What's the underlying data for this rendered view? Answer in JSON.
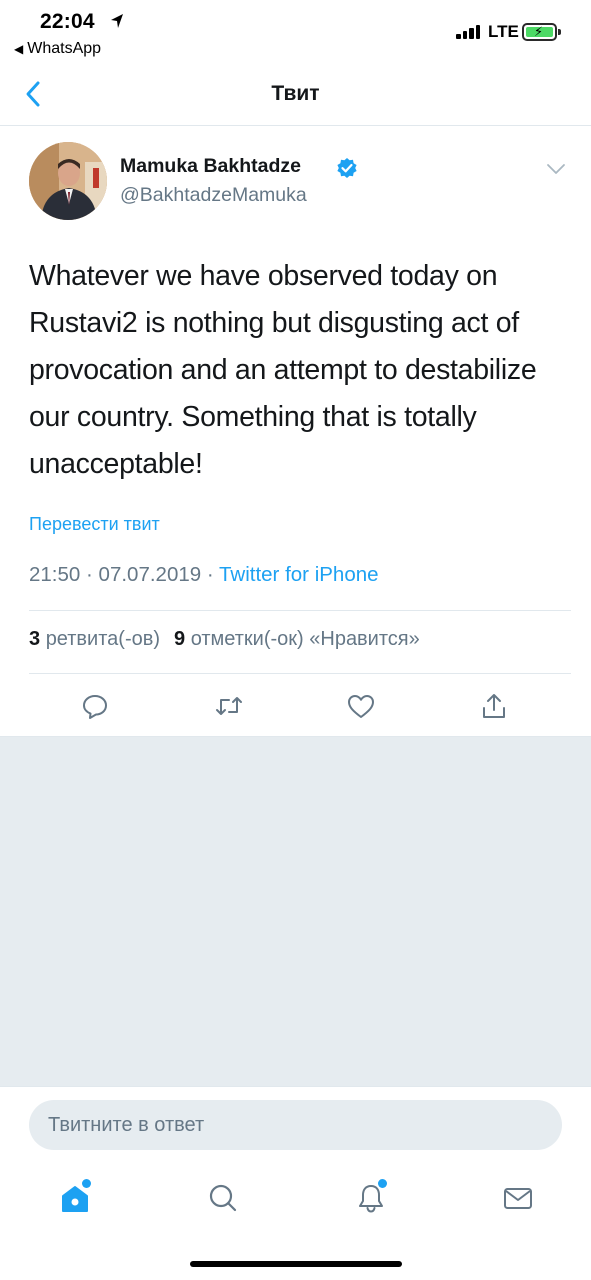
{
  "status_bar": {
    "time": "22:04",
    "back_app": "WhatsApp",
    "network": "LTE",
    "battery_color": "#4cd964"
  },
  "nav": {
    "title": "Твит",
    "back_icon": "chevron-left-icon"
  },
  "tweet": {
    "author_name": "Mamuka Bakhtadze",
    "author_handle": "@BakhtadzeMamuka",
    "verified": true,
    "text": "Whatever we have observed today on Rustavi2 is nothing but disgusting act of provocation and an attempt to destabilize our country. Something that is totally unacceptable!",
    "translate_label": "Перевести твит",
    "time": "21:50",
    "date": "07.07.2019",
    "separator": "·",
    "source": "Twitter for iPhone",
    "retweets_count": "3",
    "retweets_label": "ретвита(-ов)",
    "likes_count": "9",
    "likes_label": "отметки(-ок) «Нравится»"
  },
  "actions": [
    "reply-icon",
    "retweet-icon",
    "like-icon",
    "share-icon"
  ],
  "reply": {
    "placeholder": "Твитните в ответ"
  },
  "tabbar": [
    "home-icon",
    "search-icon",
    "notifications-icon",
    "messages-icon"
  ],
  "colors": {
    "accent": "#1da1f2",
    "secondary_text": "#657786",
    "background_grey": "#e6ecf0"
  }
}
